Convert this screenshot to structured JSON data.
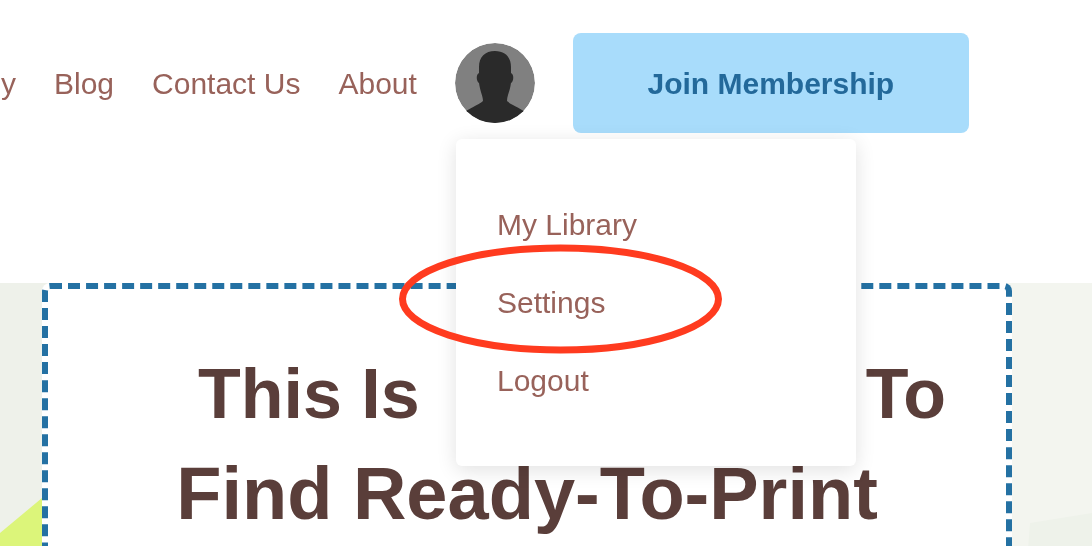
{
  "nav": {
    "links": [
      {
        "label": "y"
      },
      {
        "label": "Blog"
      },
      {
        "label": "Contact Us"
      },
      {
        "label": "About"
      }
    ],
    "join_button": "Join Membership"
  },
  "hero": {
    "heading_line_1_start": "This Is",
    "heading_line_1_end": "To",
    "heading_line_2": "Find Ready-To-Print"
  },
  "user_menu": {
    "items": [
      "My Library",
      "Settings",
      "Logout"
    ]
  }
}
